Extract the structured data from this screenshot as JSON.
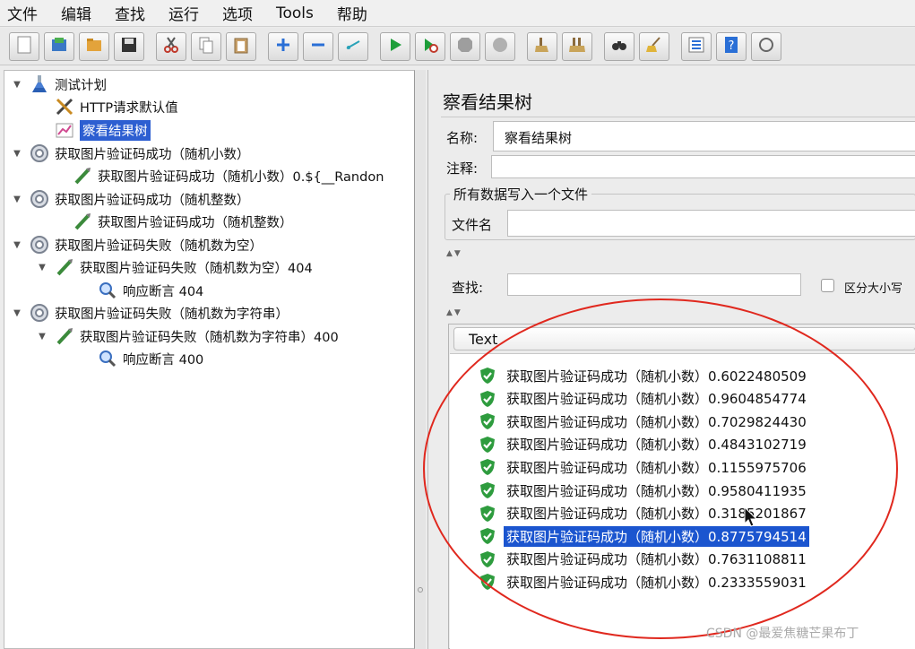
{
  "menu": [
    "文件",
    "编辑",
    "查找",
    "运行",
    "选项",
    "Tools",
    "帮助"
  ],
  "toolbar": {
    "buttons": [
      "new-icon",
      "templates-icon",
      "open-icon",
      "save-icon",
      "cut-icon",
      "copy-icon",
      "paste-icon",
      "expand-icon",
      "collapse-icon",
      "toggle-icon",
      "start-icon",
      "start-no-pause-icon",
      "stop-icon",
      "shutdown-icon",
      "clear-icon",
      "clear-all-icon",
      "search-icon",
      "reset-search-icon",
      "function-helper-icon",
      "help-icon"
    ]
  },
  "tree": [
    {
      "label": "测试计划",
      "icon": "flask-icon",
      "twisty": "▼",
      "selected": false
    },
    {
      "label": "HTTP请求默认值",
      "icon": "tools-icon",
      "twisty": "",
      "selected": false
    },
    {
      "label": "察看结果树",
      "icon": "chart-icon",
      "twisty": "",
      "selected": true
    },
    {
      "label": "获取图片验证码成功（随机小数）",
      "icon": "thread-group-icon",
      "twisty": "▼",
      "selected": false
    },
    {
      "label": "获取图片验证码成功（随机小数）0.${__Randon",
      "icon": "sampler-icon",
      "twisty": "",
      "selected": false
    },
    {
      "label": "获取图片验证码成功（随机整数）",
      "icon": "thread-group-icon",
      "twisty": "▼",
      "selected": false
    },
    {
      "label": "获取图片验证码成功（随机整数）",
      "icon": "sampler-icon",
      "twisty": "",
      "selected": false
    },
    {
      "label": "获取图片验证码失败（随机数为空）",
      "icon": "thread-group-icon",
      "twisty": "▼",
      "selected": false
    },
    {
      "label": "获取图片验证码失败（随机数为空）404",
      "icon": "sampler-icon",
      "twisty": "▼",
      "selected": false
    },
    {
      "label": "响应断言 404",
      "icon": "assertion-icon",
      "twisty": "",
      "selected": false
    },
    {
      "label": "获取图片验证码失败（随机数为字符串）",
      "icon": "thread-group-icon",
      "twisty": "▼",
      "selected": false
    },
    {
      "label": "获取图片验证码失败（随机数为字符串）400",
      "icon": "sampler-icon",
      "twisty": "▼",
      "selected": false
    },
    {
      "label": "响应断言 400",
      "icon": "assertion-icon",
      "twisty": "",
      "selected": false
    }
  ],
  "panel": {
    "title": "察看结果树",
    "name_label": "名称:",
    "name_value": "察看结果树",
    "comment_label": "注释:",
    "comment_value": "",
    "file_group_title": "所有数据写入一个文件",
    "filename_label": "文件名",
    "filename_value": "",
    "search_label": "查找:",
    "search_value": "",
    "case_label": "区分大小写",
    "case_checked": false,
    "split_arrows": "▲▼",
    "renderer": "Text"
  },
  "results": [
    {
      "text": "获取图片验证码成功（随机小数）0.6022480509",
      "status": "success",
      "selected": false
    },
    {
      "text": "获取图片验证码成功（随机小数）0.9604854774",
      "status": "success",
      "selected": false
    },
    {
      "text": "获取图片验证码成功（随机小数）0.7029824430",
      "status": "success",
      "selected": false
    },
    {
      "text": "获取图片验证码成功（随机小数）0.4843102719",
      "status": "success",
      "selected": false
    },
    {
      "text": "获取图片验证码成功（随机小数）0.1155975706",
      "status": "success",
      "selected": false
    },
    {
      "text": "获取图片验证码成功（随机小数）0.9580411935",
      "status": "success",
      "selected": false
    },
    {
      "text": "获取图片验证码成功（随机小数）0.3185201867",
      "status": "success",
      "selected": false
    },
    {
      "text": "获取图片验证码成功（随机小数）0.8775794514",
      "status": "success",
      "selected": true
    },
    {
      "text": "获取图片验证码成功（随机小数）0.7631108811",
      "status": "success",
      "selected": false
    },
    {
      "text": "获取图片验证码成功（随机小数）0.2333559031",
      "status": "success",
      "selected": false
    }
  ],
  "watermark": "CSDN @最爱焦糖芒果布丁",
  "colors": {
    "selection": "#1b55cf",
    "success_shield": "#2e9c3e",
    "annotation_ellipse": "#e0281e"
  }
}
